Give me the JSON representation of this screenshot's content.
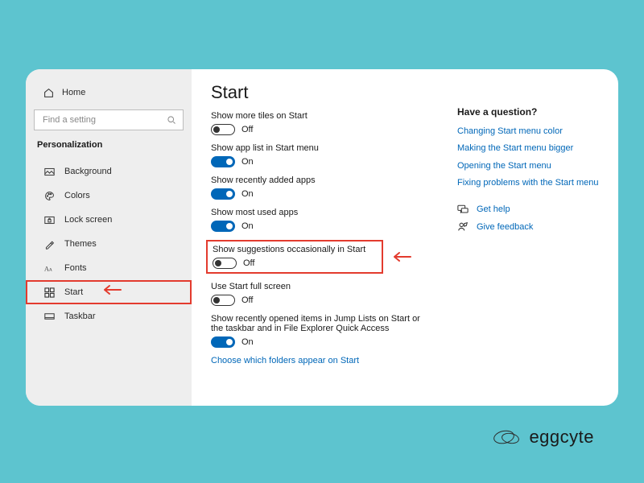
{
  "sidebar": {
    "home": "Home",
    "search_placeholder": "Find a setting",
    "section": "Personalization",
    "items": [
      {
        "icon": "image-icon",
        "label": "Background"
      },
      {
        "icon": "palette-icon",
        "label": "Colors"
      },
      {
        "icon": "lock-icon",
        "label": "Lock screen"
      },
      {
        "icon": "theme-icon",
        "label": "Themes"
      },
      {
        "icon": "font-icon",
        "label": "Fonts"
      },
      {
        "icon": "start-icon",
        "label": "Start"
      },
      {
        "icon": "taskbar-icon",
        "label": "Taskbar"
      }
    ]
  },
  "page": {
    "title": "Start",
    "settings": [
      {
        "label": "Show more tiles on Start",
        "on": false,
        "state": "Off"
      },
      {
        "label": "Show app list in Start menu",
        "on": true,
        "state": "On"
      },
      {
        "label": "Show recently added apps",
        "on": true,
        "state": "On"
      },
      {
        "label": "Show most used apps",
        "on": true,
        "state": "On"
      },
      {
        "label": "Show suggestions occasionally in Start",
        "on": false,
        "state": "Off",
        "highlighted": true
      },
      {
        "label": "Use Start full screen",
        "on": false,
        "state": "Off"
      },
      {
        "label": "Show recently opened items in Jump Lists on Start or the taskbar and in File Explorer Quick Access",
        "on": true,
        "state": "On"
      }
    ],
    "choose_folders_link": "Choose which folders appear on Start"
  },
  "help": {
    "question_title": "Have a question?",
    "links": [
      "Changing Start menu color",
      "Making the Start menu bigger",
      "Opening the Start menu",
      "Fixing problems with the Start menu"
    ],
    "get_help": "Get help",
    "give_feedback": "Give feedback"
  },
  "watermark": "eggcyte"
}
